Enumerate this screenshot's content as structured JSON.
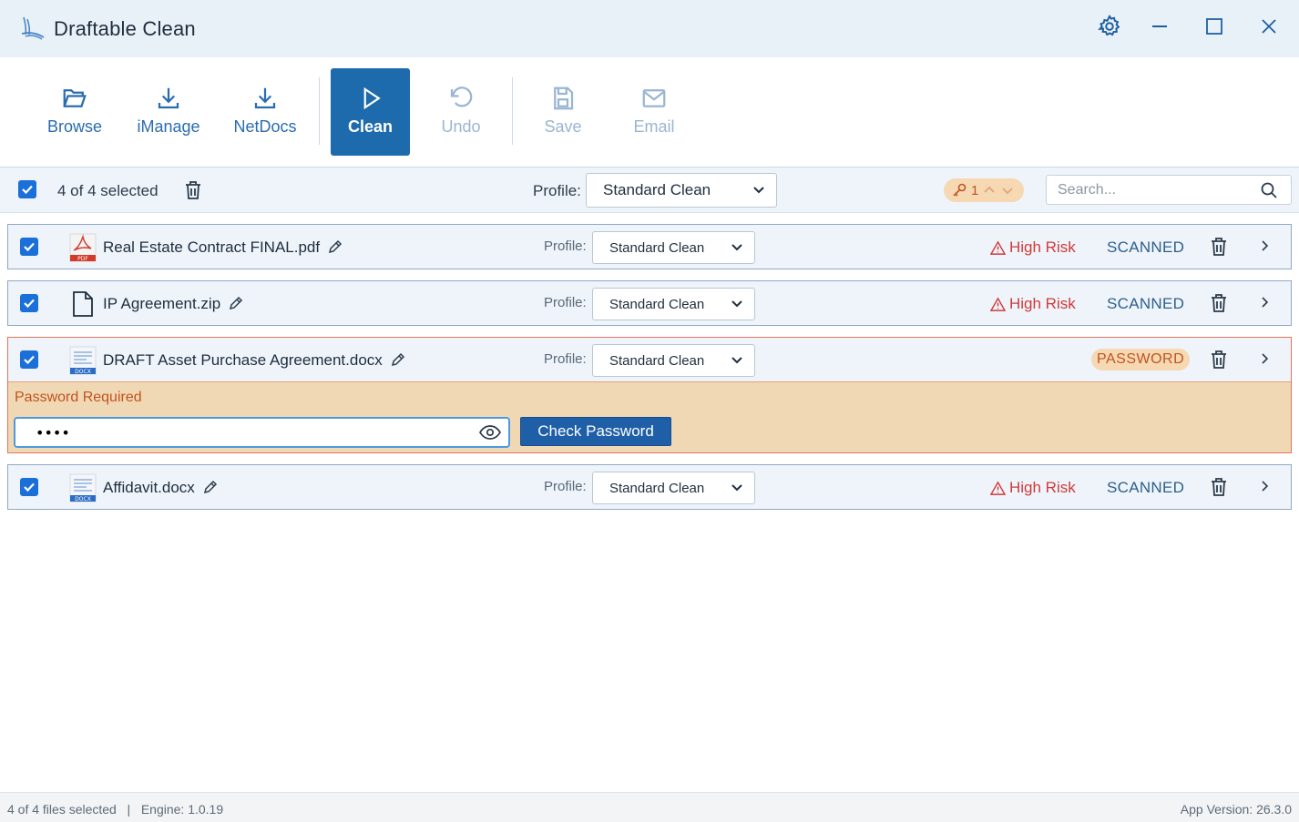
{
  "app": {
    "title": "Draftable Clean"
  },
  "toolbar": {
    "browse": "Browse",
    "imanage": "iManage",
    "netdocs": "NetDocs",
    "clean": "Clean",
    "undo": "Undo",
    "save": "Save",
    "email": "Email"
  },
  "selection": {
    "text": "4 of 4 selected",
    "profile_label": "Profile:",
    "profile_value": "Standard Clean",
    "key_count": "1",
    "search_placeholder": "Search..."
  },
  "files": [
    {
      "name": "Real Estate Contract FINAL.pdf",
      "type": "pdf",
      "profile_label": "Profile:",
      "profile": "Standard Clean",
      "risk": "High Risk",
      "status": "SCANNED"
    },
    {
      "name": "IP Agreement.zip",
      "type": "zip",
      "profile_label": "Profile:",
      "profile": "Standard Clean",
      "risk": "High Risk",
      "status": "SCANNED"
    },
    {
      "name": "DRAFT Asset Purchase Agreement.docx",
      "type": "docx",
      "profile_label": "Profile:",
      "profile": "Standard Clean",
      "status": "PASSWORD",
      "password_panel": {
        "title": "Password Required",
        "value": "••••",
        "button": "Check Password"
      }
    },
    {
      "name": "Affidavit.docx",
      "type": "docx",
      "profile_label": "Profile:",
      "profile": "Standard Clean",
      "risk": "High Risk",
      "status": "SCANNED"
    }
  ],
  "status_bar": {
    "left": "4 of 4 files selected   |   Engine: 1.0.19",
    "right": "App Version: 26.3.0"
  },
  "colors": {
    "accent": "#1d6aad",
    "risk": "#d03a3a",
    "password": "#c0541f",
    "panel": "#f1d8b4"
  },
  "icons": [
    "app-logo-icon",
    "gear-icon",
    "minimize-icon",
    "maximize-icon",
    "close-icon",
    "folder-open-icon",
    "download-icon",
    "play-icon",
    "undo-icon",
    "save-icon",
    "email-icon",
    "checkbox-icon",
    "trash-icon",
    "chevron-down-icon",
    "key-icon",
    "chevron-up-icon",
    "search-icon",
    "pdf-file-icon",
    "file-icon",
    "docx-file-icon",
    "pencil-icon",
    "warning-icon",
    "chevron-right-icon",
    "eye-icon"
  ]
}
